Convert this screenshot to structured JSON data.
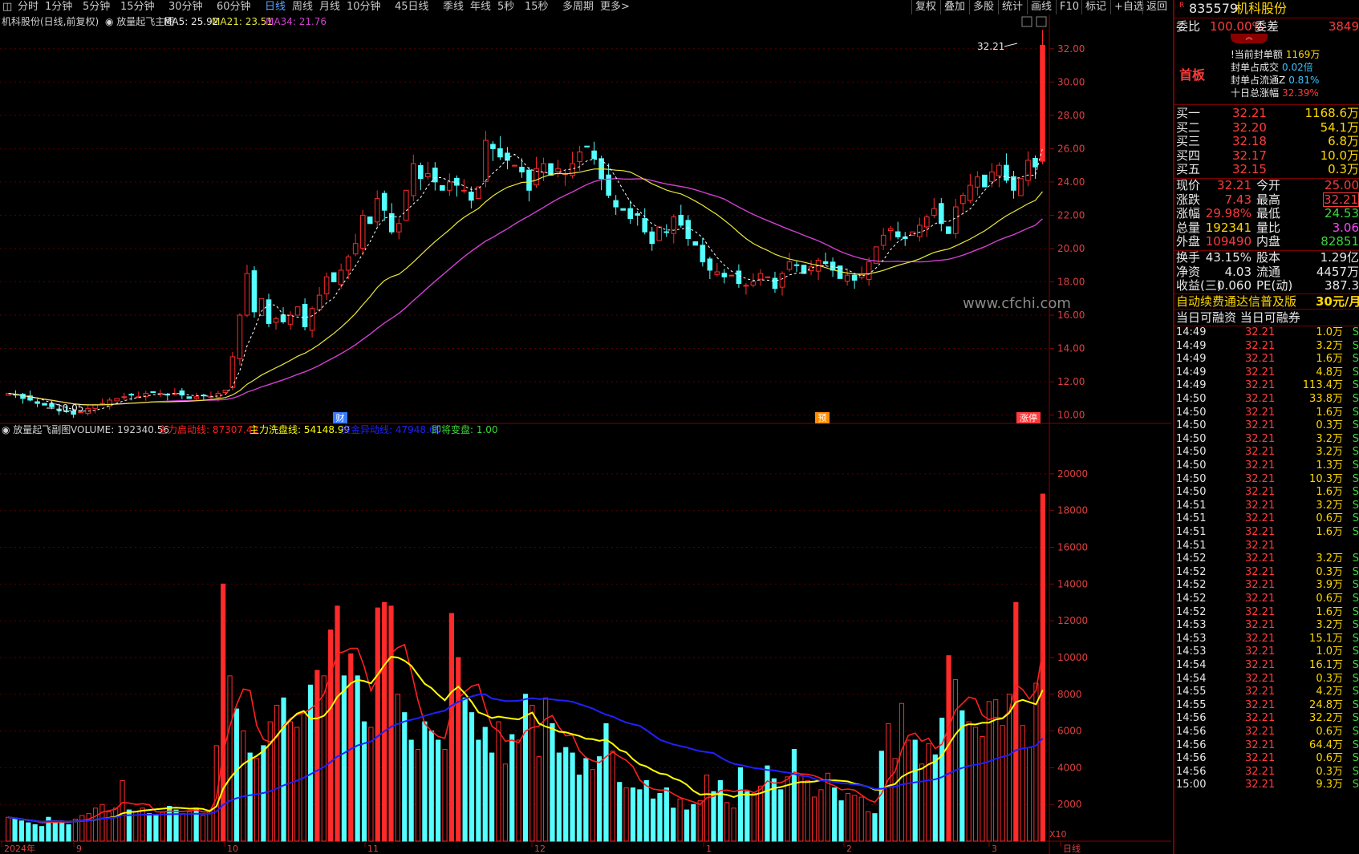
{
  "topbar": {
    "periods": [
      "分时",
      "1分钟",
      "5分钟",
      "15分钟",
      "30分钟",
      "60分钟",
      "日线",
      "周线",
      "月线",
      "10分钟",
      "45日线",
      "季线",
      "年线",
      "5秒",
      "15秒",
      "多周期",
      "更多>"
    ],
    "active_period": "日线",
    "buttons": [
      "复权",
      "叠加",
      "多股",
      "统计",
      "画线",
      "F10",
      "标记",
      "+自选",
      "返回"
    ]
  },
  "main_chart": {
    "title": "机科股份(日线,前复权)",
    "indicator_name": "放量起飞主图",
    "ma5_label": "MA5: 25.92",
    "ma21_label": "MA21: 23.51",
    "ma34_label": "MA34: 21.76",
    "high_label": "32.21",
    "low_label": "10.05",
    "markers": [
      "财",
      "预",
      "涨停"
    ],
    "watermark": "www.cfchi.com"
  },
  "sub_chart": {
    "indicator_name": "放量起飞副图",
    "volume_label": "VOLUME: 192340.56",
    "line1_label": "主力启动线: 87307.42",
    "line2_label": "主力洗盘线: 54148.99",
    "line3_label": "资金异动线: 47948.60",
    "line4_label": "即将变盘: 1.00",
    "x10_label": "X10"
  },
  "colors": {
    "up": "#ff2a2a",
    "down": "#54ffff",
    "ma5": "#ffffff",
    "ma21": "#e8e83a",
    "ma34": "#d040d0",
    "grid": "#5a0000"
  },
  "chart_data": [
    {
      "type": "candlestick",
      "title": "机科股份(日线,前复权)",
      "y_ticks": [
        "32.00",
        "30.00",
        "28.00",
        "26.00",
        "24.00",
        "22.00",
        "20.00",
        "18.00",
        "16.00",
        "14.00",
        "12.00",
        "10.00"
      ],
      "ylim": [
        9.5,
        33
      ],
      "x_month_labels": [
        "2024年",
        "9",
        "10",
        "11",
        "12",
        "1",
        "2",
        "3",
        "日线"
      ],
      "series": [
        {
          "name": "MA5",
          "last": 25.92
        },
        {
          "name": "MA21",
          "last": 23.51
        },
        {
          "name": "MA34",
          "last": 21.76
        }
      ],
      "candles_close": [
        11.3,
        11.2,
        11.0,
        10.9,
        10.7,
        10.6,
        10.5,
        10.3,
        10.2,
        10.05,
        10.2,
        10.4,
        10.6,
        10.7,
        10.9,
        11.0,
        11.1,
        11.2,
        11.1,
        11.3,
        11.4,
        11.3,
        11.2,
        11.3,
        11.2,
        11.0,
        11.1,
        11.2,
        11.1,
        11.3,
        11.5,
        13.5,
        16.0,
        18.5,
        16.2,
        17.0,
        15.5,
        15.8,
        15.6,
        16.0,
        16.5,
        15.3,
        16.4,
        17.2,
        18.3,
        18.0,
        18.7,
        19.5,
        20.3,
        22.0,
        21.5,
        23.0,
        22.3,
        21.0,
        21.5,
        23.5,
        25.1,
        24.2,
        24.5,
        24.0,
        23.5,
        24.0,
        23.8,
        23.5,
        22.9,
        23.7,
        26.5,
        26.0,
        25.5,
        25.3,
        25.0,
        24.6,
        23.5,
        24.8,
        25.1,
        24.4,
        24.8,
        24.5,
        25.1,
        25.8,
        26.1,
        25.4,
        24.2,
        23.2,
        22.5,
        22.3,
        21.8,
        22.0,
        21.0,
        20.3,
        21.3,
        21.0,
        21.9,
        21.4,
        20.6,
        20.2,
        19.2,
        18.7,
        18.6,
        18.3,
        18.4,
        17.9,
        17.8,
        18.0,
        18.5,
        18.3,
        17.6,
        18.5,
        19.2,
        19.0,
        18.5,
        18.9,
        19.3,
        19.1,
        18.7,
        18.2,
        18.4,
        18.1,
        18.4,
        19.2,
        20.1,
        20.8,
        21.2,
        20.7,
        20.6,
        21.0,
        21.4,
        21.9,
        22.4,
        21.5,
        20.9,
        22.5,
        23.2,
        23.8,
        24.3,
        23.7,
        24.6,
        25.0,
        24.1,
        23.5,
        24.2,
        25.3,
        24.9,
        32.21
      ],
      "annotations": [
        "32.21",
        "10.05",
        "财",
        "预",
        "涨停"
      ]
    },
    {
      "type": "bar",
      "title": "放量起飞副图",
      "y_ticks": [
        "20000",
        "18000",
        "16000",
        "14000",
        "12000",
        "10000",
        "8000",
        "6000",
        "4000",
        "2000"
      ],
      "ylim": [
        0,
        21000
      ],
      "series": [
        {
          "name": "VOLUME",
          "last": 192340.56
        },
        {
          "name": "主力启动线",
          "last": 87307.42
        },
        {
          "name": "主力洗盘线",
          "last": 54148.99
        },
        {
          "name": "资金异动线",
          "last": 47948.6
        },
        {
          "name": "即将变盘",
          "last": 1.0
        }
      ],
      "volume": [
        1300,
        1200,
        1100,
        1000,
        900,
        800,
        1300,
        1100,
        1000,
        900,
        1200,
        1400,
        1500,
        1800,
        2000,
        1600,
        1800,
        3300,
        1700,
        1600,
        1800,
        1500,
        1400,
        1600,
        1900,
        1700,
        1500,
        1600,
        1800,
        1400,
        1700,
        5200,
        14000,
        9000,
        7200,
        6000,
        4800,
        4500,
        5200,
        6500,
        7400,
        7800,
        6500,
        6200,
        7000,
        8500,
        9300,
        9000,
        11500,
        12800,
        9000,
        10200,
        9000,
        6500,
        6200,
        12700,
        13000,
        12800,
        8000,
        7000,
        5500,
        5000,
        6500,
        6000,
        5500,
        5000,
        12400,
        10000,
        7800,
        7000,
        5500,
        6200,
        4800,
        6500,
        4200,
        5800,
        5500,
        8000,
        7400,
        4600,
        7800,
        6400,
        4800,
        5100,
        4800,
        3600,
        4500,
        3900,
        4600,
        6400,
        4900,
        3200,
        2900,
        2900,
        2800,
        3300,
        2300,
        2600,
        2900,
        1800,
        2300,
        1700,
        2000,
        2200,
        3600,
        2700,
        3300,
        2100,
        1800,
        4000,
        2700,
        2600,
        3000,
        4100,
        3400,
        2800,
        3500,
        5000,
        3600,
        3300,
        2400,
        2800,
        3700,
        2900,
        2200,
        2600,
        2500,
        2400,
        1600,
        1500,
        4900,
        6400,
        4500,
        7500,
        5500,
        5500,
        4200,
        5300,
        4700,
        6700,
        10100,
        8800,
        7100,
        6500,
        6200,
        5700,
        7600,
        7700,
        6300,
        8000,
        13000,
        6300,
        5100,
        8600,
        18900
      ]
    }
  ],
  "panel": {
    "code": "835579",
    "name": "机科股份",
    "wb_label": "委比",
    "wb_value": "100.00%",
    "wc_label": "委差",
    "wc_value": "3849",
    "first_board": "首板",
    "seal_lines": [
      {
        "label": "!当前封单额",
        "value": "1169万",
        "color": "yel"
      },
      {
        "label": "封单占成交",
        "value": "0.02倍",
        "color": "cyan"
      },
      {
        "label": "封单占流通Z",
        "value": "0.81%",
        "color": "cyan"
      },
      {
        "label": "十日总涨幅",
        "value": "32.39%",
        "color": "red"
      }
    ],
    "bids": [
      {
        "label": "买一",
        "price": "32.21",
        "vol": "1168.6万"
      },
      {
        "label": "买二",
        "price": "32.20",
        "vol": "54.1万"
      },
      {
        "label": "买三",
        "price": "32.18",
        "vol": "6.8万"
      },
      {
        "label": "买四",
        "price": "32.17",
        "vol": "10.0万"
      },
      {
        "label": "买五",
        "price": "32.15",
        "vol": "0.3万"
      }
    ],
    "quote": [
      {
        "l1": "现价",
        "v1": "32.21",
        "c1": "red",
        "l2": "今开",
        "v2": "25.00",
        "c2": "red"
      },
      {
        "l1": "涨跌",
        "v1": "7.43",
        "c1": "red",
        "l2": "最高",
        "v2": "32.21",
        "c2": "red"
      },
      {
        "l1": "涨幅",
        "v1": "29.98%",
        "c1": "red",
        "l2": "最低",
        "v2": "24.53",
        "c2": "grn"
      },
      {
        "l1": "总量",
        "v1": "192341",
        "c1": "yel",
        "l2": "量比",
        "v2": "3.06",
        "c2": "mag"
      },
      {
        "l1": "外盘",
        "v1": "109490",
        "c1": "red",
        "l2": "内盘",
        "v2": "82851",
        "c2": "grn"
      }
    ],
    "quote2": [
      {
        "l1": "换手",
        "v1": "43.15%",
        "l2": "股本",
        "v2": "1.29亿"
      },
      {
        "l1": "净资",
        "v1": "4.03",
        "l2": "流通",
        "v2": "4457万"
      },
      {
        "l1": "收益(三)",
        "v1": "0.060",
        "l2": "PE(动)",
        "v2": "387.3"
      }
    ],
    "ad_text": "自动续费通达信普及版",
    "ad_price": "30元/月",
    "margin_text": "当日可融资 当日可融券",
    "ticks": [
      {
        "t": "14:49",
        "p": "32.21",
        "v": "1.0万",
        "s": "S"
      },
      {
        "t": "14:49",
        "p": "32.21",
        "v": "3.2万",
        "s": "S"
      },
      {
        "t": "14:49",
        "p": "32.21",
        "v": "1.6万",
        "s": "S"
      },
      {
        "t": "14:49",
        "p": "32.21",
        "v": "4.8万",
        "s": "S"
      },
      {
        "t": "14:49",
        "p": "32.21",
        "v": "113.4万",
        "s": "S"
      },
      {
        "t": "14:50",
        "p": "32.21",
        "v": "33.8万",
        "s": "S"
      },
      {
        "t": "14:50",
        "p": "32.21",
        "v": "1.6万",
        "s": "S"
      },
      {
        "t": "14:50",
        "p": "32.21",
        "v": "0.3万",
        "s": "S"
      },
      {
        "t": "14:50",
        "p": "32.21",
        "v": "3.2万",
        "s": "S"
      },
      {
        "t": "14:50",
        "p": "32.21",
        "v": "3.2万",
        "s": "S"
      },
      {
        "t": "14:50",
        "p": "32.21",
        "v": "1.3万",
        "s": "S"
      },
      {
        "t": "14:50",
        "p": "32.21",
        "v": "10.3万",
        "s": "S"
      },
      {
        "t": "14:50",
        "p": "32.21",
        "v": "1.6万",
        "s": "S"
      },
      {
        "t": "14:51",
        "p": "32.21",
        "v": "3.2万",
        "s": "S"
      },
      {
        "t": "14:51",
        "p": "32.21",
        "v": "0.6万",
        "s": "S"
      },
      {
        "t": "14:51",
        "p": "32.21",
        "v": "1.6万",
        "s": "S"
      },
      {
        "t": "14:51",
        "p": "32.21",
        "v": "",
        "s": ""
      },
      {
        "t": "14:52",
        "p": "32.21",
        "v": "3.2万",
        "s": "S"
      },
      {
        "t": "14:52",
        "p": "32.21",
        "v": "0.3万",
        "s": "S"
      },
      {
        "t": "14:52",
        "p": "32.21",
        "v": "3.9万",
        "s": "S"
      },
      {
        "t": "14:52",
        "p": "32.21",
        "v": "0.6万",
        "s": "S"
      },
      {
        "t": "14:52",
        "p": "32.21",
        "v": "1.6万",
        "s": "S"
      },
      {
        "t": "14:53",
        "p": "32.21",
        "v": "3.2万",
        "s": "S"
      },
      {
        "t": "14:53",
        "p": "32.21",
        "v": "15.1万",
        "s": "S"
      },
      {
        "t": "14:53",
        "p": "32.21",
        "v": "1.0万",
        "s": "S"
      },
      {
        "t": "14:54",
        "p": "32.21",
        "v": "16.1万",
        "s": "S"
      },
      {
        "t": "14:54",
        "p": "32.21",
        "v": "0.3万",
        "s": "S"
      },
      {
        "t": "14:55",
        "p": "32.21",
        "v": "4.2万",
        "s": "S"
      },
      {
        "t": "14:55",
        "p": "32.21",
        "v": "24.8万",
        "s": "S"
      },
      {
        "t": "14:56",
        "p": "32.21",
        "v": "32.2万",
        "s": "S"
      },
      {
        "t": "14:56",
        "p": "32.21",
        "v": "0.6万",
        "s": "S"
      },
      {
        "t": "14:56",
        "p": "32.21",
        "v": "64.4万",
        "s": "S"
      },
      {
        "t": "14:56",
        "p": "32.21",
        "v": "0.6万",
        "s": "S"
      },
      {
        "t": "14:56",
        "p": "32.21",
        "v": "0.3万",
        "s": "S"
      },
      {
        "t": "15:00",
        "p": "32.21",
        "v": "9.3万",
        "s": "S"
      }
    ]
  }
}
